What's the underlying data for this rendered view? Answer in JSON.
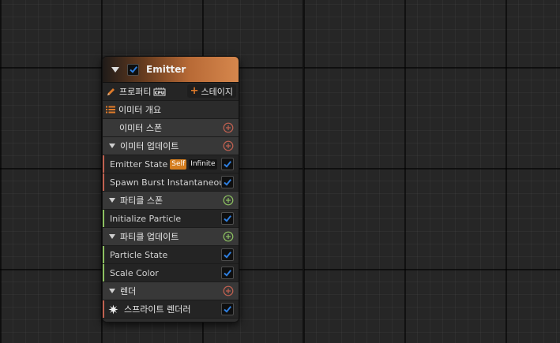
{
  "colors": {
    "emitter_accent": "#d6874d",
    "checkbox_tick": "#2f7fe0",
    "spawn_color": "#c06050",
    "update_color": "#c06050",
    "particle_spawn_color": "#8cc060",
    "particle_update_color": "#8cc060",
    "render_color": "#c06050"
  },
  "node": {
    "title": "Emitter",
    "enabled": true,
    "toolbar": {
      "properties_label": "프로퍼티",
      "sim_target_icon": "cpu-icon",
      "add_stage_label": "스테이지"
    },
    "summary_label": "이미터 개요",
    "sections": {
      "emitter_spawn": {
        "label": "이미터 스폰"
      },
      "emitter_update": {
        "label": "이미터 업데이트",
        "items": [
          {
            "label": "Emitter State",
            "tag_self": "Self",
            "tag_infinite": "Infinite",
            "enabled": true
          },
          {
            "label": "Spawn Burst Instantaneous",
            "enabled": true
          }
        ]
      },
      "particle_spawn": {
        "label": "파티클 스폰",
        "items": [
          {
            "label": "Initialize Particle",
            "enabled": true
          }
        ]
      },
      "particle_update": {
        "label": "파티클 업데이트",
        "items": [
          {
            "label": "Particle State",
            "enabled": true
          },
          {
            "label": "Scale Color",
            "enabled": true
          }
        ]
      },
      "render": {
        "label": "렌더",
        "items": [
          {
            "label": "스프라이트 렌더러",
            "icon": "sprite-renderer-icon",
            "enabled": true
          }
        ]
      }
    }
  }
}
